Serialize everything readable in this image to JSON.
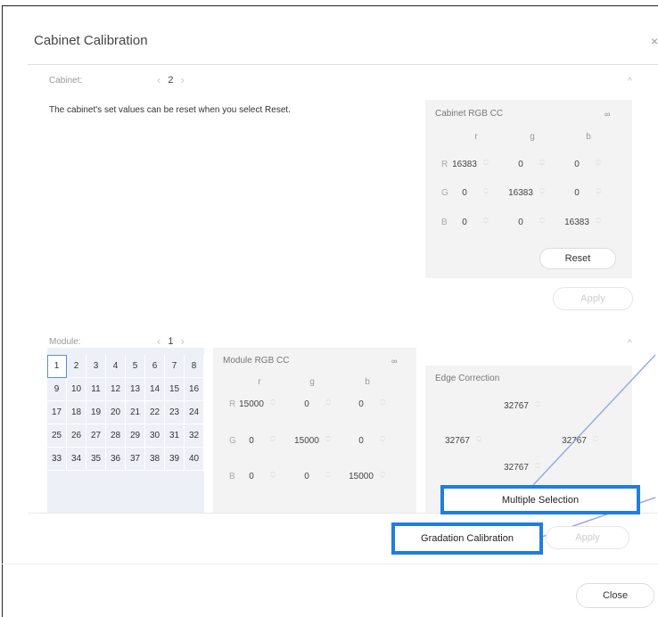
{
  "dialog": {
    "title": "Cabinet Calibration",
    "close_glyph": "×"
  },
  "cabinet": {
    "label": "Cabinet:",
    "value": "2",
    "prev": "‹",
    "next": "›",
    "collapse": "^",
    "info": "The cabinet's set values can be reset when you select Reset.",
    "rgb": {
      "title": "Cabinet RGB CC",
      "link_glyph": "∞",
      "cols": [
        "r",
        "g",
        "b"
      ],
      "rows": [
        {
          "label": "R",
          "values": [
            "16383",
            "0",
            "0"
          ]
        },
        {
          "label": "G",
          "values": [
            "0",
            "16383",
            "0"
          ]
        },
        {
          "label": "B",
          "values": [
            "0",
            "0",
            "16383"
          ]
        }
      ],
      "reset_label": "Reset"
    },
    "apply_label": "Apply"
  },
  "module": {
    "label": "Module:",
    "value": "1",
    "prev": "‹",
    "next": "›",
    "collapse": "^",
    "grid": [
      [
        "1",
        "2",
        "3",
        "4",
        "5",
        "6",
        "7",
        "8"
      ],
      [
        "9",
        "10",
        "11",
        "12",
        "13",
        "14",
        "15",
        "16"
      ],
      [
        "17",
        "18",
        "19",
        "20",
        "21",
        "22",
        "23",
        "24"
      ],
      [
        "25",
        "26",
        "27",
        "28",
        "29",
        "30",
        "31",
        "32"
      ],
      [
        "33",
        "34",
        "35",
        "36",
        "37",
        "38",
        "39",
        "40"
      ]
    ],
    "rgb": {
      "title": "Module RGB CC",
      "link_glyph": "∞",
      "cols": [
        "r",
        "g",
        "b"
      ],
      "rows": [
        {
          "label": "R",
          "values": [
            "15000",
            "0",
            "0"
          ]
        },
        {
          "label": "G",
          "values": [
            "0",
            "15000",
            "0"
          ]
        },
        {
          "label": "B",
          "values": [
            "0",
            "0",
            "15000"
          ]
        }
      ]
    },
    "edge": {
      "title": "Edge Correction",
      "top": "32767",
      "left": "32767",
      "right": "32767",
      "bottom": "32767"
    },
    "multiple_selection_label": "Multiple Selection",
    "gradation_label": "Gradation Calibration",
    "apply_label": "Apply"
  },
  "footer": {
    "close_label": "Close"
  },
  "colors": {
    "highlight": "#1e7ee0",
    "callout": "#9aa8e8"
  }
}
